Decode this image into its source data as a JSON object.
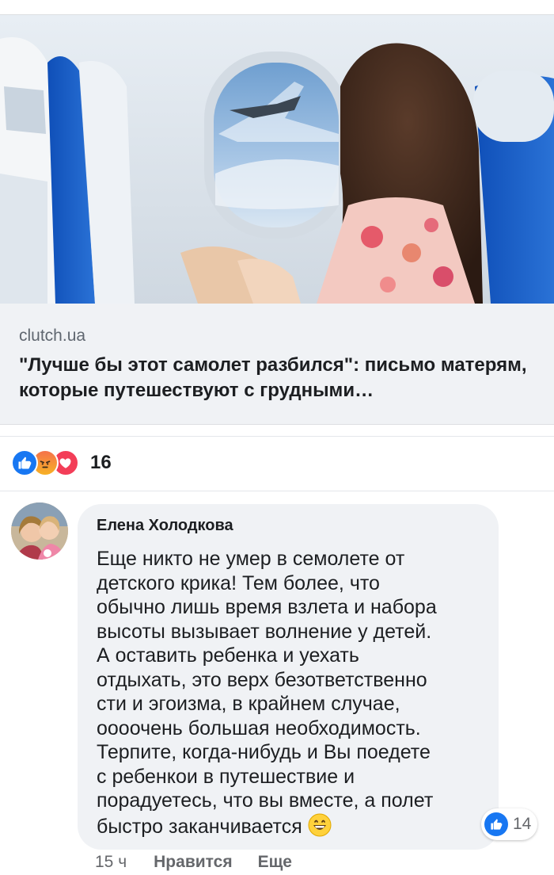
{
  "link_preview": {
    "image_alt": "woman-reading-on-airplane",
    "domain": "clutch.ua",
    "title": "\"Лучше бы этот самолет разбился\": письмо матерям, которые путешествуют с грудными…"
  },
  "reactions": {
    "icons": [
      "like-icon",
      "angry-icon",
      "love-icon"
    ],
    "count": "16"
  },
  "comment": {
    "author": "Елена Холодкова",
    "text": "Еще никто не умер в семолете от\nдетского крика! Тем более, что\nобычно лишь время взлета и набора\nвысоты вызывает волнение у детей.\nА оставить ребенка и уехать\nотдыхать, это верх безответственно\nсти и эгоизма, в крайнем случае,\nоооочень большая необходимость.\nТерпите, когда-нибудь и Вы поедете\nс ребенкои в путешествие и\nпорадуетесь, что вы вместе, а полет\nбыстро заканчивается",
    "emoji": "grinning-face-emoji",
    "like_count": "14",
    "time": "15 ч",
    "like_label": "Нравится",
    "more_label": "Еще"
  },
  "colors": {
    "fb_blue": "#1877f2",
    "love_red": "#f33e58",
    "card_bg": "#f0f2f5",
    "muted_text": "#65676b"
  }
}
